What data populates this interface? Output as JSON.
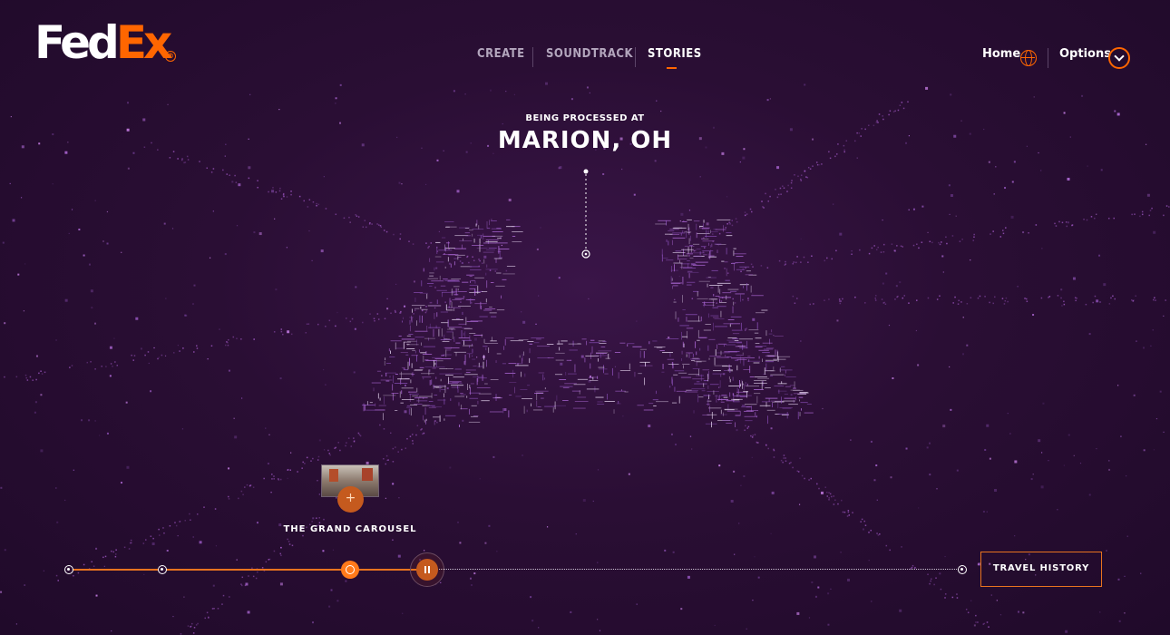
{
  "brand": {
    "fed": "Fed",
    "ex": "Ex",
    "reg": "®"
  },
  "nav": {
    "items": [
      {
        "label": "CREATE"
      },
      {
        "label": "SOUNDTRACK"
      },
      {
        "label": "STORIES"
      }
    ],
    "active": "STORIES"
  },
  "header_right": {
    "home_label": "Home",
    "options_label": "Options"
  },
  "location": {
    "status": "BEING PROCESSED AT",
    "city": "MARION, OH"
  },
  "story": {
    "label": "THE GRAND CAROUSEL"
  },
  "timeline": {
    "button_label": "TRAVEL HISTORY"
  },
  "colors": {
    "accent": "#ff6600",
    "background": "#2a0e34",
    "particles": "#b06ad8"
  },
  "icons": [
    "globe-icon",
    "chevron-down-icon",
    "plus-icon",
    "pause-icon"
  ]
}
